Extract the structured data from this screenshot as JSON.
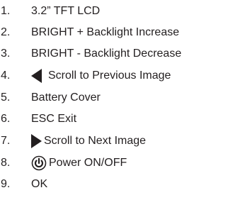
{
  "items": [
    {
      "num": "1.",
      "text": "3.2” TFT LCD"
    },
    {
      "num": "2.",
      "text": "BRIGHT + Backlight Increase"
    },
    {
      "num": "3.",
      "text": "BRIGHT - Backlight Decrease"
    },
    {
      "num": "4.",
      "text": "Scroll to Previous Image",
      "icon": "left-triangle-icon"
    },
    {
      "num": "5.",
      "text": "Battery Cover"
    },
    {
      "num": "6.",
      "text": "ESC Exit"
    },
    {
      "num": "7.",
      "text": "Scroll to Next Image",
      "icon": "right-triangle-icon"
    },
    {
      "num": "8.",
      "text": "Power ON/OFF",
      "icon": "power-icon"
    },
    {
      "num": "9.",
      "text": "OK"
    }
  ],
  "colors": {
    "text": "#231f20",
    "background": "#ffffff"
  }
}
